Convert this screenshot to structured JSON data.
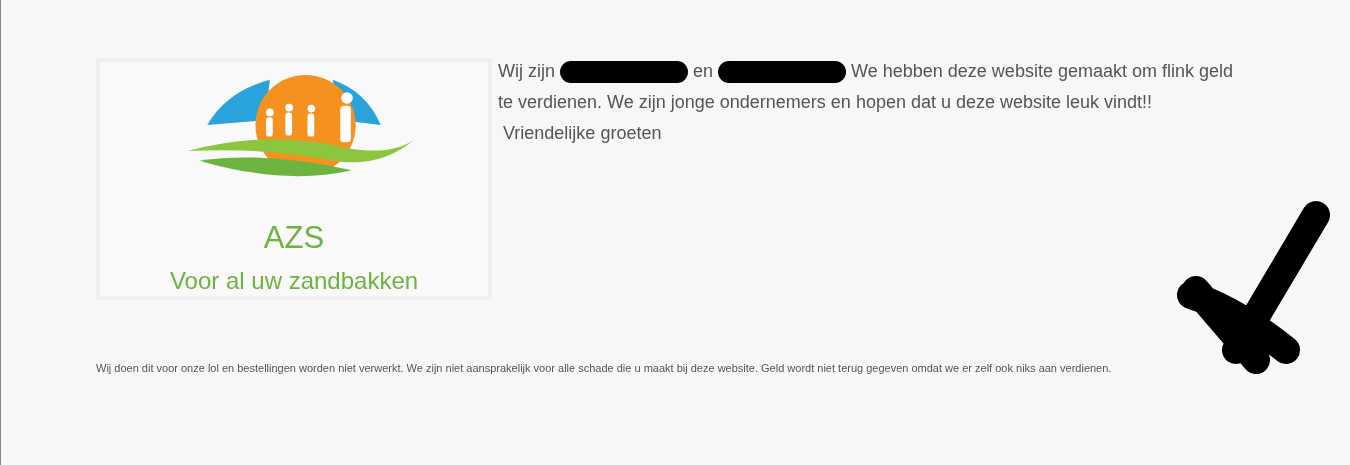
{
  "logo": {
    "title": "AZS",
    "tagline": "Voor al uw zandbakken"
  },
  "intro": [
    {
      "kind": "text",
      "text": "Wij zijn"
    },
    {
      "kind": "redaction"
    },
    {
      "kind": "text",
      "text": "en"
    },
    {
      "kind": "redaction"
    },
    {
      "kind": "text",
      "text": "We hebben deze website gemaakt om flink geld"
    },
    {
      "kind": "line",
      "text": "te verdienen. We zijn jonge ondernemers en hopen dat u deze website leuk vindt!!"
    }
  ],
  "greeting": "Vriendelijke groeten",
  "disclaimer": "Wij doen dit voor onze lol en bestellingen worden niet verwerkt. We zijn niet aansprakelijk voor alle schade die u maakt bij deze website. Geld wordt niet terug gegeven omdat we er zelf ook niks aan verdienen."
}
